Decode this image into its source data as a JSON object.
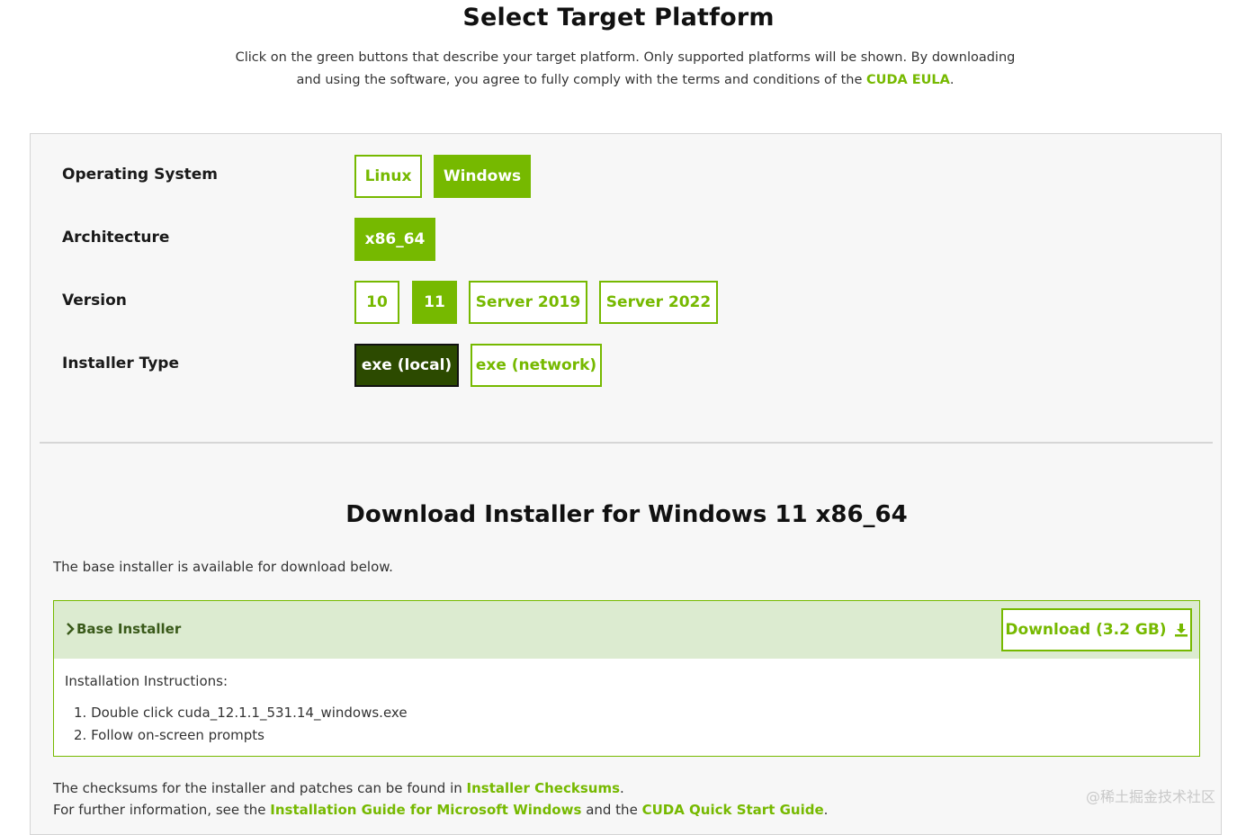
{
  "header": {
    "title": "Select Target Platform",
    "intro_line1": "Click on the green buttons that describe your target platform. Only supported platforms will be shown. By downloading",
    "intro_line2_prefix": "and using the software, you agree to fully comply with the terms and conditions of the",
    "eula_link": "CUDA EULA",
    "intro_line2_suffix": "."
  },
  "selector": {
    "os": {
      "label": "Operating System",
      "options": [
        "Linux",
        "Windows"
      ],
      "selected": "Windows"
    },
    "architecture": {
      "label": "Architecture",
      "options": [
        "x86_64"
      ],
      "selected": "x86_64"
    },
    "version": {
      "label": "Version",
      "options": [
        "10",
        "11",
        "Server 2019",
        "Server 2022"
      ],
      "selected": "11"
    },
    "installer_type": {
      "label": "Installer Type",
      "options": [
        "exe (local)",
        "exe (network)"
      ],
      "selected": "exe (local)"
    }
  },
  "download": {
    "heading": "Download Installer for Windows 11 x86_64",
    "base_available": "The base installer is available for download below.",
    "installer_title": "Base Installer",
    "download_label": "Download (3.2 GB)",
    "instructions_label": "Installation Instructions:",
    "steps": [
      "1. Double click cuda_12.1.1_531.14_windows.exe",
      "2. Follow on-screen prompts"
    ]
  },
  "footer": {
    "checksums_prefix": "The checksums for the installer and patches can be found in",
    "checksums_link": "Installer Checksums",
    "checksums_suffix": ".",
    "info_prefix": "For further information, see the",
    "guide_link": "Installation Guide for Microsoft Windows",
    "info_middle": "and the",
    "quickstart_link": "CUDA Quick Start Guide",
    "info_suffix": "."
  },
  "watermark": "@稀土掘金技术社区",
  "colors": {
    "accent": "#76b900",
    "active": "#2c4a00",
    "header_bg": "#dcebd0"
  },
  "icons": {
    "expand": "chevron-right-icon",
    "download": "download-icon"
  }
}
